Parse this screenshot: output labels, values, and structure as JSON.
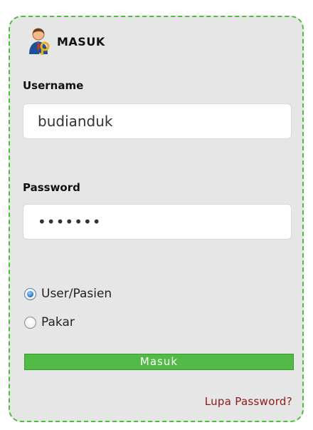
{
  "login": {
    "title": "MASUK",
    "icon": "user-key-icon",
    "username_label": "Username",
    "username_value": "budianduk",
    "password_label": "Password",
    "password_value": "•••••••",
    "role_options": [
      {
        "label": "User/Pasien",
        "checked": true
      },
      {
        "label": "Pakar",
        "checked": false
      }
    ],
    "submit_label": "Masuk",
    "forgot_label": "Lupa Password?"
  },
  "colors": {
    "border": "#4cbf3a",
    "panel_bg": "#e6e6e6",
    "button_bg": "#52bb48",
    "link": "#8b1a1a"
  }
}
